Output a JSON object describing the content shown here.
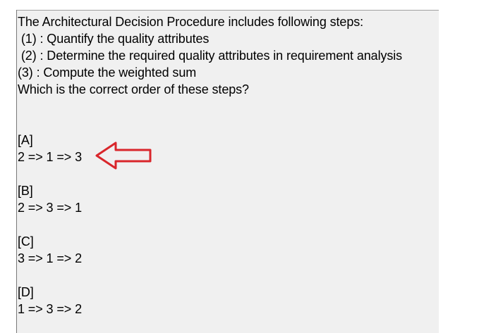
{
  "question": {
    "intro": "The Architectural Decision Procedure includes following steps:",
    "steps": [
      " (1) : Quantify the quality attributes",
      " (2) : Determine the required quality attributes in requirement analysis",
      "(3) : Compute the weighted sum"
    ],
    "prompt": "Which is the correct order of these steps?"
  },
  "options": [
    {
      "label": "[A]",
      "answer": "2 => 1 => 3"
    },
    {
      "label": "[B]",
      "answer": "2 => 3 => 1"
    },
    {
      "label": "[C]",
      "answer": "3 => 1 => 2"
    },
    {
      "label": "[D]",
      "answer": "1 => 3 => 2"
    }
  ],
  "annotation": {
    "icon": "left-arrow-icon",
    "color": "#d9262b",
    "points_to": "[A]"
  },
  "colors": {
    "panel_background": "#f0f0f0",
    "text": "#000000"
  }
}
